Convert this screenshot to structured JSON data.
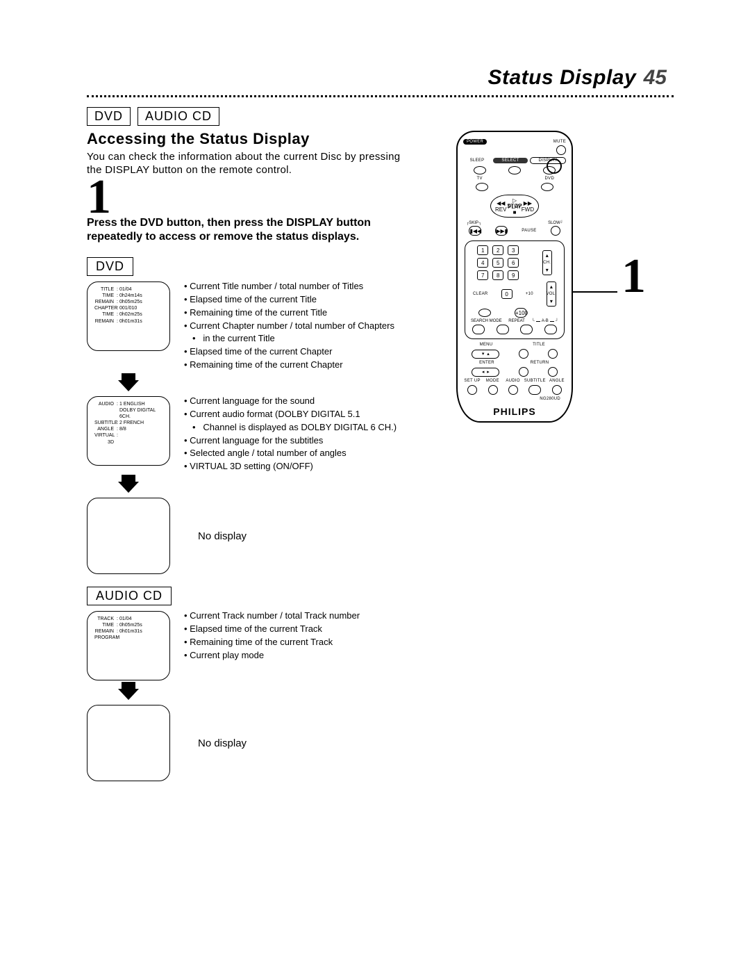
{
  "header": {
    "title": "Status Display",
    "page": "45"
  },
  "format_tags": {
    "dvd": "DVD",
    "audio_cd": "AUDIO CD"
  },
  "section_title": "Accessing the Status Display",
  "intro": "You can check the information about the current Disc by pressing the DISPLAY button on the remote control.",
  "step": {
    "num": "1",
    "text": "Press the DVD button, then press the DISPLAY button repeatedly to access or remove the status displays."
  },
  "dvd": {
    "heading": "DVD",
    "screen1": {
      "rows": [
        {
          "k": "TITLE",
          "v": "01/04"
        },
        {
          "k": "TIME",
          "v": "0h24m14s"
        },
        {
          "k": "REMAIN",
          "v": "0h05m25s"
        },
        {
          "k": "",
          "v": ""
        },
        {
          "k": "CHAPTER",
          "v": "001/010"
        },
        {
          "k": "TIME",
          "v": "0h02m25s"
        },
        {
          "k": "REMAIN",
          "v": "0h01m31s"
        }
      ]
    },
    "bullets1": [
      "Current Title number / total number of Titles",
      "Elapsed time of the current Title",
      "Remaining time of the current Title",
      "Current Chapter number / total number of Chapters",
      "in the current Title",
      "Elapsed time of the current Chapter",
      "Remaining time of the current Chapter"
    ],
    "screen2": {
      "rows": [
        {
          "k": "AUDIO",
          "v": "1 ENGLISH"
        },
        {
          "k": "",
          "v": "DOLBY DIGITAL"
        },
        {
          "k": "",
          "v": "6CH."
        },
        {
          "k": "SUBTITLE",
          "v": "2 FRENCH"
        },
        {
          "k": "ANGLE",
          "v": "8/8"
        },
        {
          "k": "VIRTUAL 3D",
          "v": ""
        }
      ]
    },
    "bullets2": [
      "Current language for the sound",
      "Current audio format (DOLBY DIGITAL 5.1",
      "Channel is displayed as DOLBY DIGITAL 6 CH.)",
      "Current language for the subtitles",
      "Selected angle / total number of angles",
      "VIRTUAL 3D setting (ON/OFF)"
    ],
    "no_display": "No display"
  },
  "audio_cd": {
    "heading": "AUDIO CD",
    "screen": {
      "rows": [
        {
          "k": "TRACK",
          "v": "01/04"
        },
        {
          "k": "TIME",
          "v": "0h05m25s"
        },
        {
          "k": "REMAIN",
          "v": "0h01m31s"
        },
        {
          "k": "",
          "v": ""
        },
        {
          "k": "PROGRAM",
          "v": ""
        }
      ]
    },
    "bullets": [
      "Current Track number / total Track number",
      "Elapsed time of the current Track",
      "Remaining time of the current Track",
      "Current play mode"
    ],
    "no_display": "No display"
  },
  "remote": {
    "callout": "1",
    "brand": "PHILIPS",
    "model": "NG280UD",
    "labels": {
      "power": "POWER",
      "mute": "MUTE",
      "sleep": "SLEEP",
      "select": "SELECT",
      "display": "DISPLAY",
      "tv": "TV",
      "dvd": "DVD",
      "play": "PLAY",
      "rev": "REV",
      "fwd": "FWD",
      "stop": "STOP",
      "skip": "SKIP",
      "slow": "SLOW",
      "pause": "PAUSE",
      "clear": "CLEAR",
      "plus10": "+10",
      "plus100": "+100",
      "searchmode": "SEARCH MODE",
      "repeat": "REPEAT",
      "ab": "A-B",
      "ch": "CH.",
      "vol": "VOL.",
      "menu": "MENU",
      "title": "TITLE",
      "enter": "ENTER",
      "return": "RETURN",
      "setup": "SET UP",
      "mode": "MODE",
      "audio": "AUDIO",
      "subtitle": "SUBTITLE",
      "angle": "ANGLE"
    },
    "keys": [
      "1",
      "2",
      "3",
      "4",
      "5",
      "6",
      "7",
      "8",
      "9",
      "0"
    ]
  }
}
